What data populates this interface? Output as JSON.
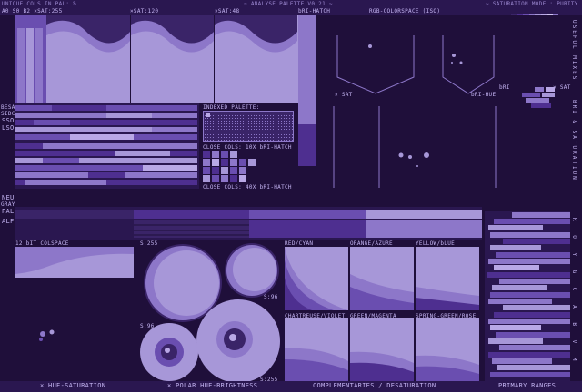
{
  "header": {
    "left_line1": "UNIQUE COLS IN PAL: %",
    "left_line2": "A0 S0 B2 ×SAT:255",
    "sat120": "×SAT:120",
    "sat48": "×SAT:48",
    "bri_hatch_top": "bRI-HATCH",
    "title": "~ ANALYSE PALETTE V0.21 ~",
    "colorspace": "RGB-COLORSPACE (ISO)",
    "sat_model": "~ SATURATION MODEL: PURITY"
  },
  "left_labels": {
    "besa": "BESA",
    "sidc": "SIDC",
    "sso": "SSO",
    "lso": "LSO",
    "neu": "NEU",
    "gray": "GRAY",
    "pal": "PAL",
    "alf": "ALF"
  },
  "indexed": {
    "title": "INDEXED PALETTE:",
    "close10": "CLOSE COLS: 10X bRI-HATCH",
    "close40": "CLOSE COLS: 40X bRI-HATCH"
  },
  "rgb": {
    "sat_left": "× SAT",
    "bri_hue": "bRI-HUE",
    "bri": "bRI",
    "sat_right": "× SAT"
  },
  "right_vertical": {
    "useful_mixes": "USEFUL MIXES",
    "bri_saturation": "BRI & SATURATION",
    "hues": "R O Y G C A B V M"
  },
  "colspace": {
    "title": "12 bIT COLSPACE"
  },
  "polar": {
    "s255_top": "S:255",
    "s96_top": "S:96",
    "s96_bottom": "S:96",
    "s255_bottom": "S:255"
  },
  "complementaries": [
    "RED/CYAN",
    "ORANGE/AZURE",
    "YELLOW/bLUE",
    "CHARTREUSE/VIOLET",
    "GREEN/MAGENTA",
    "SPRING-GREEN/ROSE"
  ],
  "footer": {
    "hue_saturation": "× HUE-SATURATION",
    "polar": "× POLAR HUE-BRIGHTNESS",
    "complementaries": "COMPLEMENTARIES / DESATURATION",
    "primary": "PRIMARY RANGES"
  },
  "colors": {
    "background": "#1f0f3a",
    "panel": "#3a2468",
    "light": "#8d77c9",
    "pale": "#b9a8e6",
    "deep": "#4e2f90",
    "text": "#c2b2f0"
  }
}
